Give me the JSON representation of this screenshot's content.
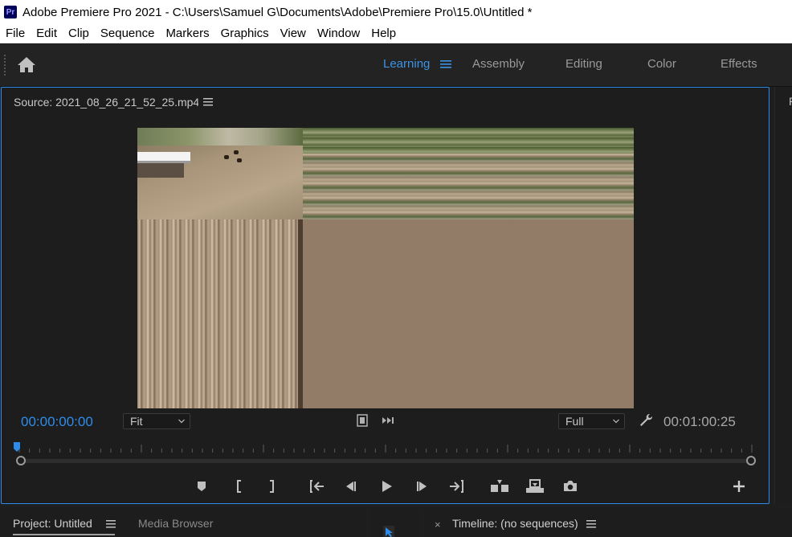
{
  "window": {
    "app_icon_text": "Pr",
    "title": "Adobe Premiere Pro 2021 - C:\\Users\\Samuel G\\Documents\\Adobe\\Premiere Pro\\15.0\\Untitled *"
  },
  "menubar": {
    "items": [
      "File",
      "Edit",
      "Clip",
      "Sequence",
      "Markers",
      "Graphics",
      "View",
      "Window",
      "Help"
    ]
  },
  "workspaces": {
    "active": "Learning",
    "tabs": [
      "Learning",
      "Assembly",
      "Editing",
      "Color",
      "Effects"
    ]
  },
  "source_monitor": {
    "title": "Source: 2021_08_26_21_52_25.mp4",
    "timecode_current": "00:00:00:00",
    "zoom_value": "Fit",
    "resolution_value": "Full",
    "timecode_duration": "00:01:00:25",
    "playhead_position": 0.0
  },
  "right_panel": {
    "label": "P"
  },
  "bottom_panels": {
    "project_tab": "Project: Untitled",
    "media_browser_tab": "Media Browser",
    "timeline_close": "×",
    "timeline_tab": "Timeline: (no sequences)"
  },
  "colors": {
    "accent": "#2d8ceb",
    "panel_bg": "#1d1d1d",
    "app_bg": "#232323"
  }
}
